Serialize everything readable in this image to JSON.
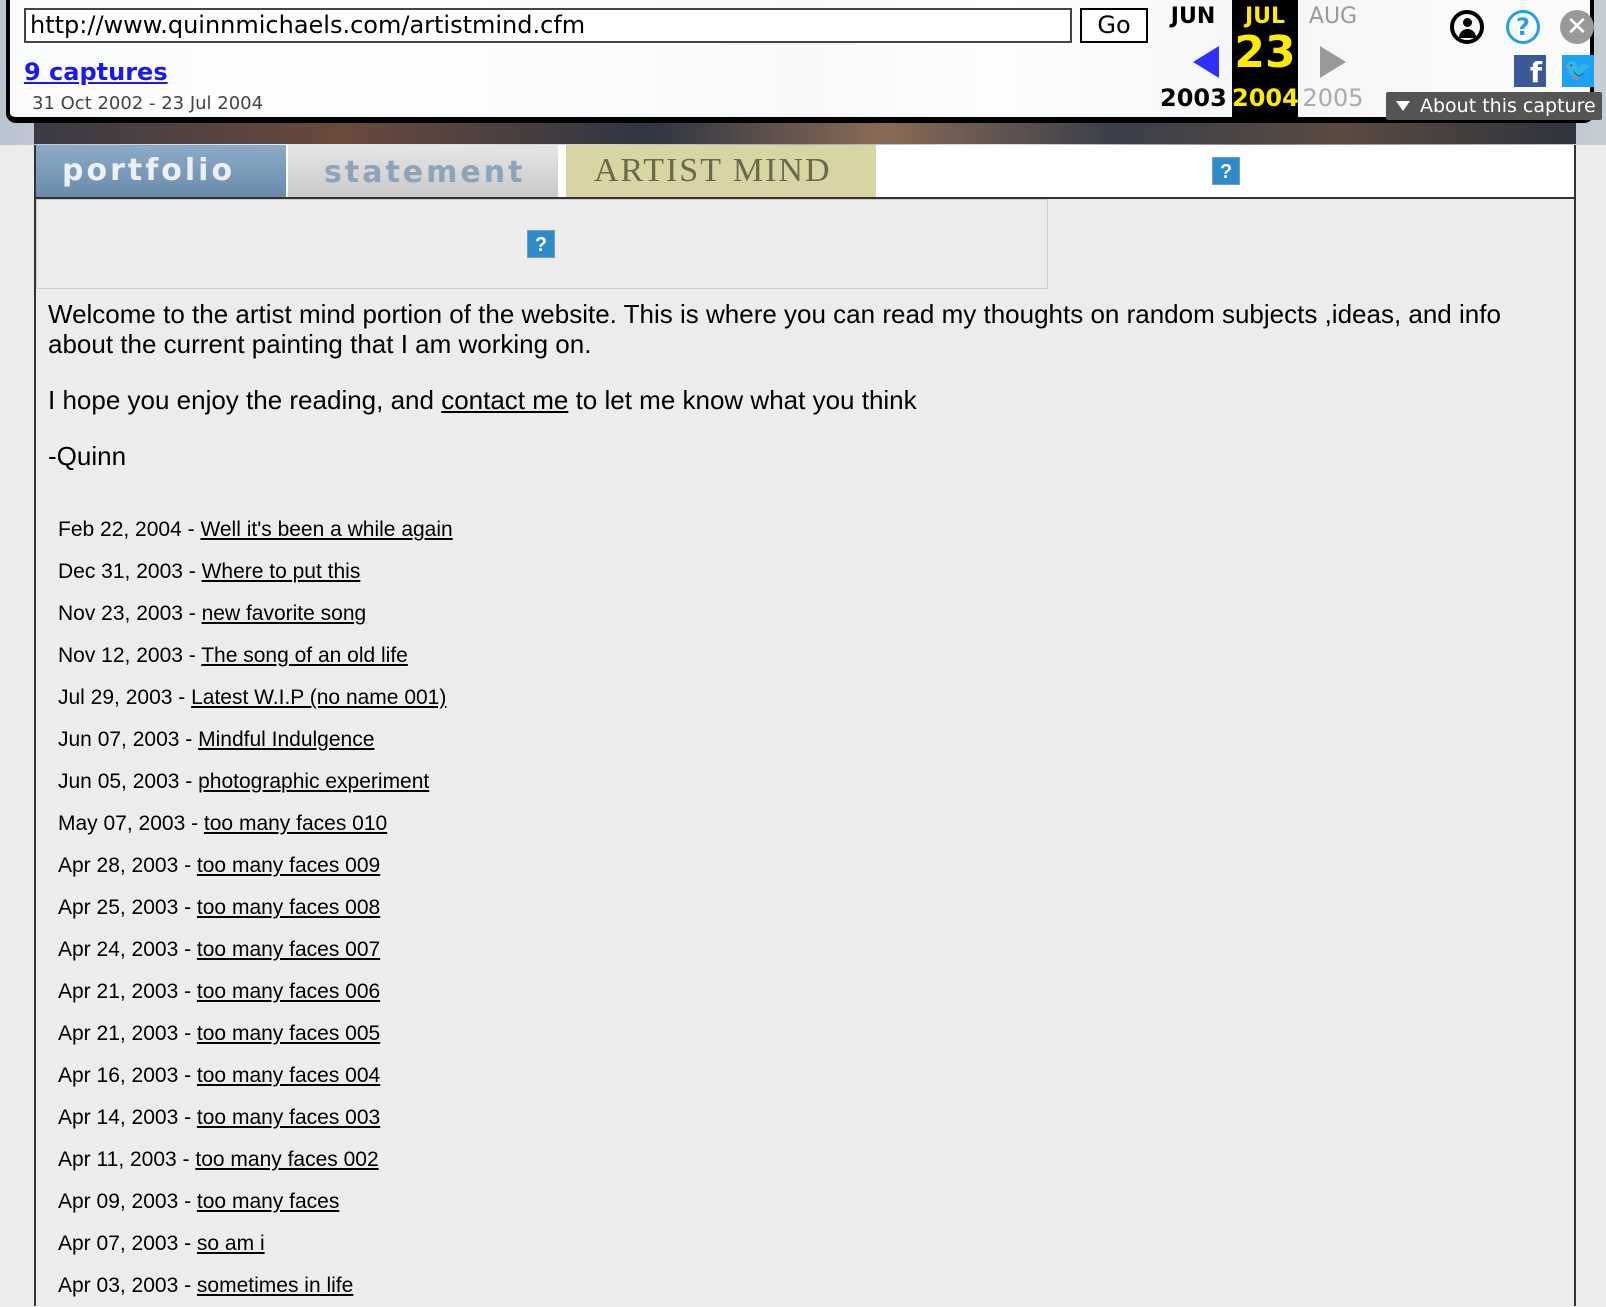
{
  "wayback": {
    "url": "http://www.quinnmichaels.com/artistmind.cfm",
    "go_label": "Go",
    "captures_label": "9 captures",
    "range": "31 Oct 2002 - 23 Jul 2004",
    "prev": {
      "month": "JUN",
      "year": "2003"
    },
    "current": {
      "month": "JUL",
      "day": "23",
      "year": "2004"
    },
    "next": {
      "month": "AUG",
      "year": "2005"
    },
    "about_label": "About this capture",
    "colors": {
      "accent": "#ffeb00",
      "link": "#1a1aee"
    }
  },
  "nav": {
    "tabs": [
      {
        "label": "portfolio"
      },
      {
        "label": "statement"
      },
      {
        "label": "ARTIST MIND"
      }
    ],
    "broken_image_glyph": "?"
  },
  "header": {
    "broken_image_glyph": "?"
  },
  "intro": {
    "p1": "Welcome to the artist mind portion of the website. This is where you can read my thoughts on random subjects ,ideas, and info about the current painting that I am working on.",
    "p2_before": "I hope you enjoy the reading, and ",
    "p2_link": "contact me",
    "p2_after": " to let me know what you think",
    "signature": "-Quinn"
  },
  "entries": [
    {
      "date": "Feb 22, 2004 - ",
      "title": "Well it's been a while again"
    },
    {
      "date": "Dec 31, 2003 - ",
      "title": "Where to put this"
    },
    {
      "date": "Nov 23, 2003 - ",
      "title": "new favorite song"
    },
    {
      "date": "Nov 12, 2003 - ",
      "title": "The song of an old life"
    },
    {
      "date": "Jul 29, 2003 - ",
      "title": "Latest W.I.P (no name 001)"
    },
    {
      "date": "Jun 07, 2003 - ",
      "title": "Mindful Indulgence"
    },
    {
      "date": "Jun 05, 2003 - ",
      "title": "photographic experiment"
    },
    {
      "date": "May 07, 2003 - ",
      "title": "too many faces 010"
    },
    {
      "date": "Apr 28, 2003 - ",
      "title": "too many faces 009"
    },
    {
      "date": "Apr 25, 2003 - ",
      "title": "too many faces 008"
    },
    {
      "date": "Apr 24, 2003 - ",
      "title": "too many faces 007"
    },
    {
      "date": "Apr 21, 2003 - ",
      "title": "too many faces 006"
    },
    {
      "date": "Apr 21, 2003 - ",
      "title": "too many faces 005"
    },
    {
      "date": "Apr 16, 2003 - ",
      "title": "too many faces 004"
    },
    {
      "date": "Apr 14, 2003 - ",
      "title": "too many faces 003"
    },
    {
      "date": "Apr 11, 2003 - ",
      "title": "too many faces 002"
    },
    {
      "date": "Apr 09, 2003 - ",
      "title": "too many faces"
    },
    {
      "date": "Apr 07, 2003 - ",
      "title": "so am i"
    },
    {
      "date": "Apr 03, 2003 - ",
      "title": "sometimes in life"
    }
  ]
}
